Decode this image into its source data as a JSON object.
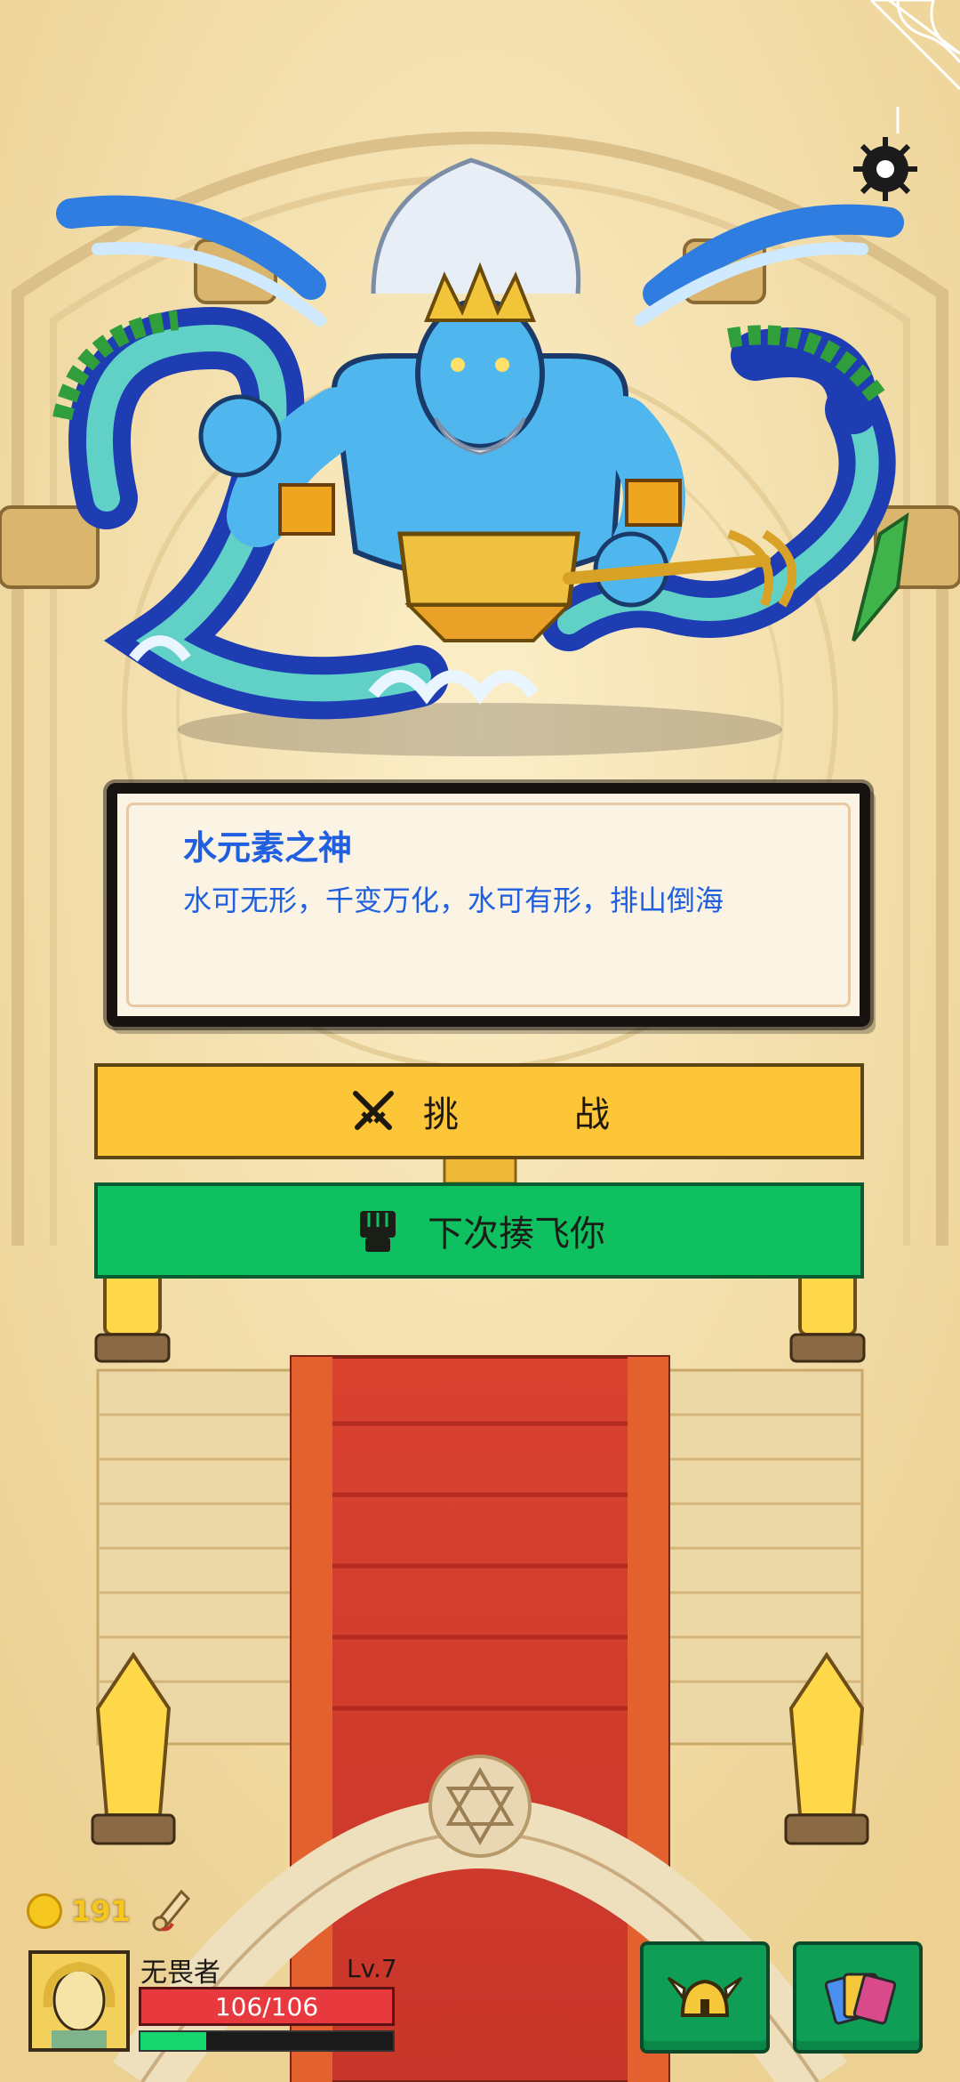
{
  "boss": {
    "name": "水元素之神",
    "description": "水可无形，千变万化，水可有形，排山倒海"
  },
  "actions": {
    "challenge_part1": "挑",
    "challenge_part2": "战",
    "later_label": "下次揍飞你"
  },
  "player": {
    "coins": "191",
    "name": "无畏者",
    "level": "Lv.7",
    "hp": "106/106",
    "xp_fraction": 0.26
  },
  "icons": {
    "coin": "coin-icon",
    "scroll": "scroll-icon",
    "swords": "crossed-swords-icon",
    "fist": "fist-icon",
    "helmet": "helmet-icon",
    "cards": "cards-icon",
    "settings": "gear-icon"
  },
  "colors": {
    "title_blue": "#1f5fe0",
    "challenge_yellow": "#fdc538",
    "later_green": "#0fc060",
    "hp_red": "#e83a3e",
    "xp_green": "#16d670"
  }
}
